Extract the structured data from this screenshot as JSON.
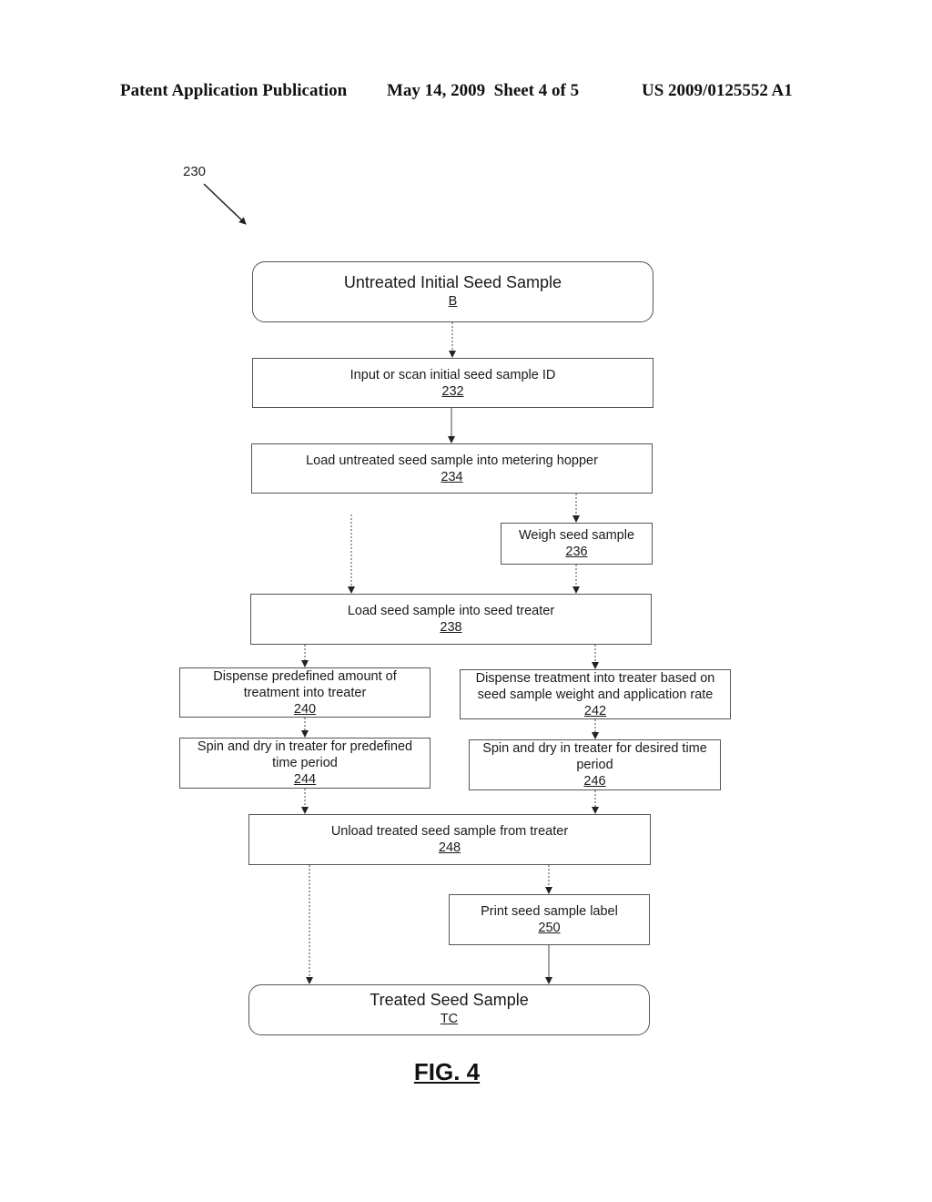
{
  "header": {
    "publication": "Patent Application Publication",
    "date_sheet": "May 14, 2009  Sheet 4 of 5",
    "patent_number": "US 2009/0125552 A1"
  },
  "reference_numeral": "230",
  "flowchart": {
    "start": {
      "label": "Untreated Initial Seed Sample",
      "ref": "B"
    },
    "steps": [
      {
        "id": "232",
        "label": "Input or scan initial seed sample ID"
      },
      {
        "id": "234",
        "label": "Load untreated seed sample into metering hopper"
      },
      {
        "id": "236",
        "label": "Weigh seed sample"
      },
      {
        "id": "238",
        "label": "Load seed sample into seed treater"
      },
      {
        "id": "240",
        "label": "Dispense predefined amount of treatment into treater"
      },
      {
        "id": "242",
        "label": "Dispense treatment into treater based on seed sample weight and application rate"
      },
      {
        "id": "244",
        "label": "Spin and dry in treater for predefined time period"
      },
      {
        "id": "246",
        "label": "Spin and dry in treater for desired time period"
      },
      {
        "id": "248",
        "label": "Unload treated seed sample from treater"
      },
      {
        "id": "250",
        "label": "Print seed sample label"
      }
    ],
    "end": {
      "label": "Treated Seed Sample",
      "ref": "TC"
    }
  },
  "figure_label": "FIG. 4"
}
